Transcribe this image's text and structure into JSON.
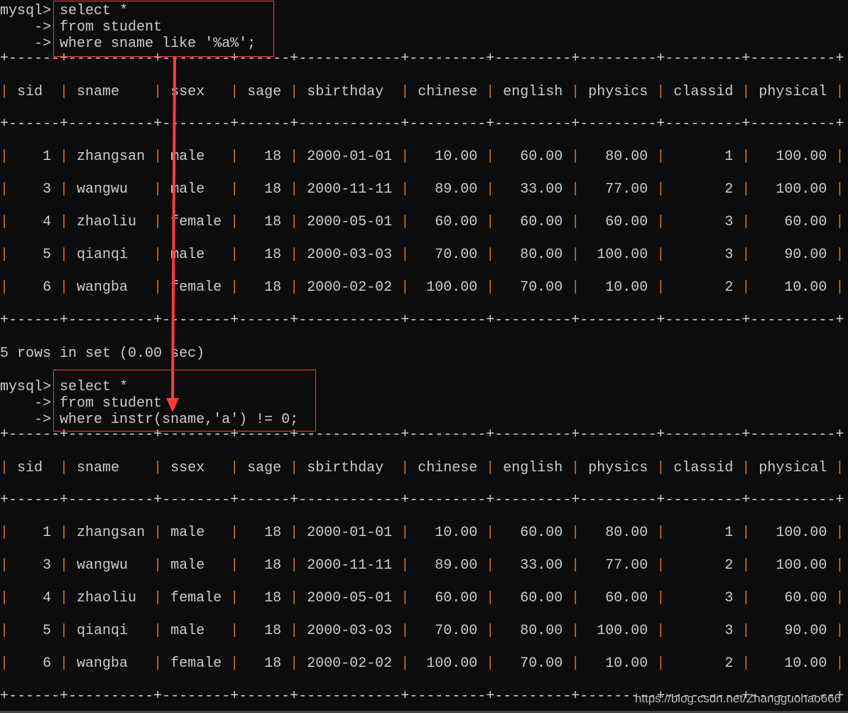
{
  "queries": [
    {
      "prompt": [
        "mysql>",
        "    ->",
        "    ->"
      ],
      "lines": [
        "select *",
        "from student",
        "where sname like '%a%';"
      ],
      "status": "5 rows in set (0.00 sec)"
    },
    {
      "prompt": [
        "mysql>",
        "    ->",
        "    ->"
      ],
      "lines": [
        "select *",
        "from student",
        "where instr(sname,'a') != 0;"
      ]
    }
  ],
  "table": {
    "columns": [
      "sid",
      "sname",
      "ssex",
      "sage",
      "sbirthday",
      "chinese",
      "english",
      "physics",
      "classid",
      "physical"
    ],
    "rows": [
      [
        "1",
        "zhangsan",
        "male",
        "18",
        "2000-01-01",
        "10.00",
        "60.00",
        "80.00",
        "1",
        "100.00"
      ],
      [
        "3",
        "wangwu",
        "male",
        "18",
        "2000-11-11",
        "89.00",
        "33.00",
        "77.00",
        "2",
        "100.00"
      ],
      [
        "4",
        "zhaoliu",
        "female",
        "18",
        "2000-05-01",
        "60.00",
        "60.00",
        "60.00",
        "3",
        "60.00"
      ],
      [
        "5",
        "qianqi",
        "male",
        "18",
        "2000-03-03",
        "70.00",
        "80.00",
        "100.00",
        "3",
        "90.00"
      ],
      [
        "6",
        "wangba",
        "female",
        "18",
        "2000-02-02",
        "100.00",
        "70.00",
        "10.00",
        "2",
        "10.00"
      ]
    ]
  },
  "watermark": "https://blog.csdn.net/Zhangguohao666",
  "colors": {
    "background": "#0c0c0c",
    "text": "#cccccc",
    "border": "#c8742a",
    "annotation": "#ff3b3b"
  }
}
